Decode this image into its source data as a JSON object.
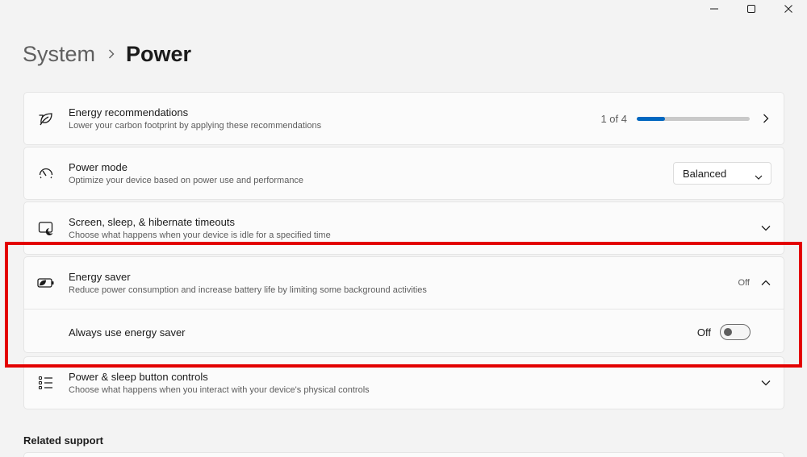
{
  "window": {
    "minimize_icon": "minimize-icon",
    "maximize_icon": "maximize-icon",
    "close_icon": "close-icon"
  },
  "breadcrumb": {
    "parent": "System",
    "current": "Power"
  },
  "energy_recommendations": {
    "icon": "leaf-icon",
    "title": "Energy recommendations",
    "subtitle": "Lower your carbon footprint by applying these recommendations",
    "progress_text": "1 of 4",
    "progress_value": 0.25,
    "progress_color": "#0067c0"
  },
  "power_mode": {
    "icon": "power-mode-icon",
    "title": "Power mode",
    "subtitle": "Optimize your device based on power use and performance",
    "selected": "Balanced"
  },
  "screen_sleep": {
    "icon": "screen-sleep-icon",
    "title": "Screen, sleep, & hibernate timeouts",
    "subtitle": "Choose what happens when your device is idle for a specified time"
  },
  "energy_saver": {
    "icon": "energy-saver-icon",
    "title": "Energy saver",
    "subtitle": "Reduce power consumption and increase battery life by limiting some background activities",
    "status": "Off",
    "always_label": "Always use energy saver",
    "toggle_label": "Off",
    "toggle_on": false,
    "highlight_color": "#e30000"
  },
  "power_buttons": {
    "icon": "list-icon",
    "title": "Power & sleep button controls",
    "subtitle": "Choose what happens when you interact with your device's physical controls"
  },
  "related_support": {
    "label": "Related support"
  }
}
